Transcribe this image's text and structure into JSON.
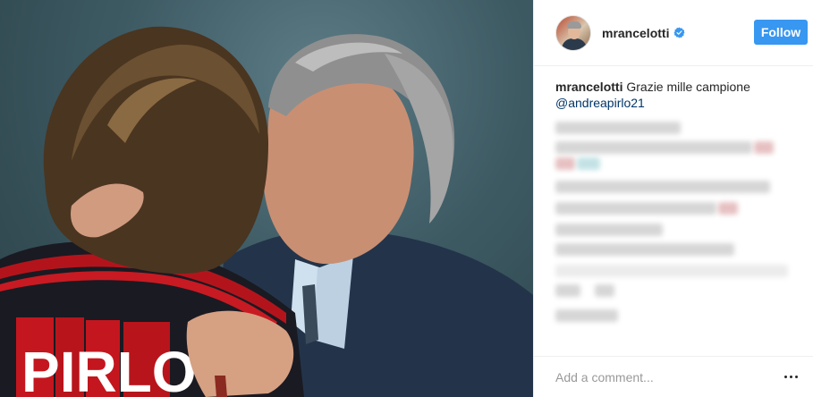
{
  "post": {
    "photo_alt": "",
    "jersey_text": "PIRLO"
  },
  "header": {
    "username": "mrancelotti",
    "verified": true,
    "follow_label": "Follow"
  },
  "caption": {
    "username": "mrancelotti",
    "text": "Grazie mille campione",
    "mention": "@andreapirlo21"
  },
  "comment_box": {
    "placeholder": "Add a comment..."
  },
  "colors": {
    "follow_button": "#3897f0",
    "verified_badge": "#3897f0",
    "mention": "#003569",
    "border": "#efefef"
  },
  "icons": {
    "verified": "verified-badge-icon",
    "more": "more-options-icon"
  }
}
